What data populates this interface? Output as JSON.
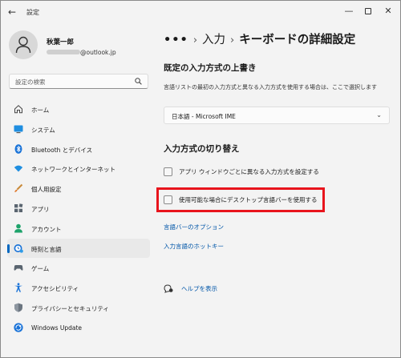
{
  "titlebar": {
    "title": "設定",
    "back_glyph": "←",
    "minimize_glyph": "—",
    "close_glyph": "✕"
  },
  "profile": {
    "name": "秋葉一郎",
    "email_domain": "@outlook.jp"
  },
  "search": {
    "placeholder": "設定の検索"
  },
  "sidebar": {
    "items": [
      {
        "label": "ホーム",
        "icon": "home-icon"
      },
      {
        "label": "システム",
        "icon": "system-icon"
      },
      {
        "label": "Bluetooth とデバイス",
        "icon": "bluetooth-icon"
      },
      {
        "label": "ネットワークとインターネット",
        "icon": "wifi-icon"
      },
      {
        "label": "個人用設定",
        "icon": "brush-icon"
      },
      {
        "label": "アプリ",
        "icon": "apps-icon"
      },
      {
        "label": "アカウント",
        "icon": "account-icon"
      },
      {
        "label": "時刻と言語",
        "icon": "time-language-icon",
        "active": true
      },
      {
        "label": "ゲーム",
        "icon": "gaming-icon"
      },
      {
        "label": "アクセシビリティ",
        "icon": "accessibility-icon"
      },
      {
        "label": "プライバシーとセキュリティ",
        "icon": "shield-icon"
      },
      {
        "label": "Windows Update",
        "icon": "windows-update-icon"
      }
    ]
  },
  "breadcrumb": {
    "dots": "•••",
    "sep": "›",
    "parent": "入力",
    "current": "キーボードの詳細設定"
  },
  "override": {
    "title": "既定の入力方式の上書き",
    "description": "言語リストの最初の入力方式と異なる入力方式を使用する場合は、ここで選択します",
    "dropdown_value": "日本語 - Microsoft IME"
  },
  "switching": {
    "title": "入力方式の切り替え",
    "checkbox1_label": "アプリ ウィンドウごとに異なる入力方式を設定する",
    "checkbox2_label": "使用可能な場合にデスクトップ言語バーを使用する",
    "checkbox1_checked": false,
    "checkbox2_checked": false
  },
  "links": {
    "language_bar_options": "言語バーのオプション",
    "hotkeys": "入力言語のホットキー",
    "help": "ヘルプを表示"
  },
  "colors": {
    "accent": "#0067c0",
    "link": "#0056a8",
    "highlight": "#e8141c"
  }
}
